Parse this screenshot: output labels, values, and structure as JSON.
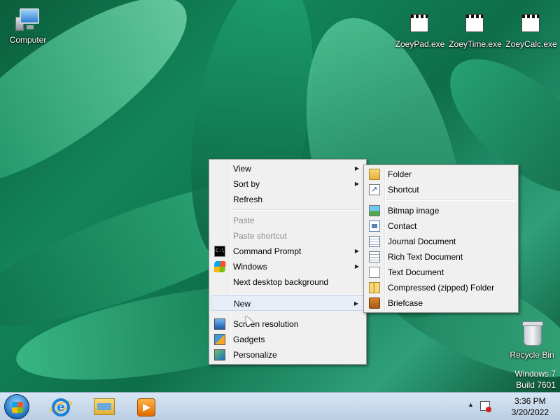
{
  "desktop": {
    "icons": [
      {
        "label": "Computer",
        "icon": "computer-icon"
      },
      {
        "label": "ZoeyPad.exe",
        "icon": "exe-icon"
      },
      {
        "label": "ZoeyTime.exe",
        "icon": "exe-icon"
      },
      {
        "label": "ZoeyCalc.exe",
        "icon": "exe-icon"
      },
      {
        "label": "Recycle Bin",
        "icon": "recycle-bin-icon"
      }
    ],
    "watermark": {
      "line1": "Windows 7",
      "line2": "Build 7601"
    }
  },
  "context_menu": {
    "items": [
      {
        "label": "View",
        "submenu": true
      },
      {
        "label": "Sort by",
        "submenu": true
      },
      {
        "label": "Refresh"
      },
      {
        "label": "Paste",
        "disabled": true
      },
      {
        "label": "Paste shortcut",
        "disabled": true
      },
      {
        "label": "Command Prompt",
        "submenu": true,
        "icon": "command-prompt-icon"
      },
      {
        "label": "Windows",
        "submenu": true,
        "icon": "windows-logo-icon"
      },
      {
        "label": "Next desktop background"
      },
      {
        "label": "New",
        "submenu": true
      },
      {
        "label": "Screen resolution",
        "icon": "screen-resolution-icon"
      },
      {
        "label": "Gadgets",
        "icon": "gadgets-icon"
      },
      {
        "label": "Personalize",
        "icon": "personalize-icon"
      }
    ],
    "arrow": "▶"
  },
  "new_submenu": {
    "items": [
      {
        "label": "Folder",
        "icon": "folder-icon"
      },
      {
        "label": "Shortcut",
        "icon": "shortcut-icon"
      },
      {
        "label": "Bitmap image",
        "icon": "bitmap-icon"
      },
      {
        "label": "Contact",
        "icon": "contact-icon"
      },
      {
        "label": "Journal Document",
        "icon": "journal-icon"
      },
      {
        "label": "Rich Text Document",
        "icon": "rich-text-icon"
      },
      {
        "label": "Text Document",
        "icon": "text-document-icon"
      },
      {
        "label": "Compressed (zipped) Folder",
        "icon": "zip-folder-icon"
      },
      {
        "label": "Briefcase",
        "icon": "briefcase-icon"
      }
    ]
  },
  "taskbar": {
    "pinned": [
      {
        "name": "internet-explorer-icon"
      },
      {
        "name": "windows-explorer-icon"
      },
      {
        "name": "media-player-icon"
      }
    ],
    "tray": {
      "show_hidden": "▲"
    },
    "clock": {
      "time": "3:36 PM",
      "date": "3/20/2022"
    }
  }
}
